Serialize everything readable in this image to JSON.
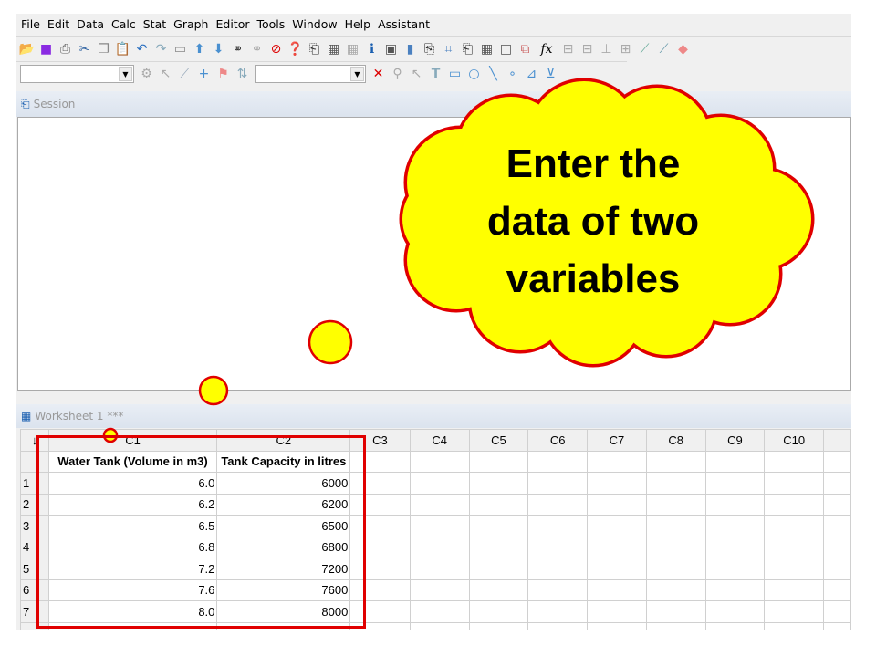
{
  "menu": [
    "File",
    "Edit",
    "Data",
    "Calc",
    "Stat",
    "Graph",
    "Editor",
    "Tools",
    "Window",
    "Help",
    "Assistant"
  ],
  "session": {
    "title": "Session"
  },
  "worksheet": {
    "title": "Worksheet 1 ***",
    "columns": [
      "C1",
      "C2",
      "C3",
      "C4",
      "C5",
      "C6",
      "C7",
      "C8",
      "C9",
      "C10"
    ],
    "names": [
      "Water Tank (Volume in m3)",
      "Tank Capacity in litres"
    ],
    "rows": [
      [
        "1",
        "6.0",
        "6000"
      ],
      [
        "2",
        "6.2",
        "6200"
      ],
      [
        "3",
        "6.5",
        "6500"
      ],
      [
        "4",
        "6.8",
        "6800"
      ],
      [
        "5",
        "7.2",
        "7200"
      ],
      [
        "6",
        "7.6",
        "7600"
      ],
      [
        "7",
        "8.0",
        "8000"
      ]
    ]
  },
  "callout": {
    "lines": [
      "Enter the",
      "data of two",
      "variables"
    ],
    "fill": "#ffff00",
    "stroke": "#e00000"
  },
  "toolbar1_icons": [
    "open-icon",
    "save-icon",
    "print-icon",
    "cut-icon",
    "copy-icon",
    "paste-icon",
    "undo-icon",
    "redo-icon",
    "window-icon",
    "up-icon",
    "down-icon",
    "find-icon",
    "replace-icon",
    "cancel-icon",
    "help-icon",
    "session-icon",
    "worksheet-icon",
    "graph-icon",
    "info-icon",
    "command-icon",
    "report-icon",
    "new-icon",
    "project-icon",
    "history-icon",
    "table-icon",
    "layout-icon",
    "close-graphs-icon",
    "fx-icon"
  ],
  "toolbar2_icons": [
    "brush-icon",
    "select-icon",
    "pen-icon",
    "crosshair-icon",
    "flag-icon",
    "swap-icon",
    "delete-icon",
    "zoom-icon",
    "pointer-icon",
    "text-icon",
    "rectangle-icon",
    "ellipse-icon",
    "line-icon",
    "dot-icon",
    "polyline-icon",
    "polygon-icon"
  ]
}
